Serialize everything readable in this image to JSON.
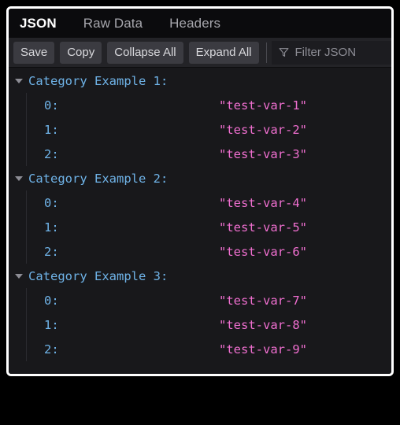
{
  "panel": {
    "name": "firefox-devtools-json-viewer"
  },
  "tabs": [
    {
      "label": "JSON",
      "active": true
    },
    {
      "label": "Raw Data",
      "active": false
    },
    {
      "label": "Headers",
      "active": false
    }
  ],
  "toolbar": {
    "save_label": "Save",
    "copy_label": "Copy",
    "collapse_all_label": "Collapse All",
    "expand_all_label": "Expand All",
    "filter_placeholder": "Filter JSON",
    "filter_value": "",
    "filter_icon": "funnel-icon"
  },
  "tree": {
    "twisty_icon": "triangle-down-icon",
    "groups": [
      {
        "key": "Category Example 1:",
        "expanded": true,
        "items": [
          {
            "key": "0:",
            "value": "\"test-var-1\""
          },
          {
            "key": "1:",
            "value": "\"test-var-2\""
          },
          {
            "key": "2:",
            "value": "\"test-var-3\""
          }
        ]
      },
      {
        "key": "Category Example 2:",
        "expanded": true,
        "items": [
          {
            "key": "0:",
            "value": "\"test-var-4\""
          },
          {
            "key": "1:",
            "value": "\"test-var-5\""
          },
          {
            "key": "2:",
            "value": "\"test-var-6\""
          }
        ]
      },
      {
        "key": "Category Example 3:",
        "expanded": true,
        "items": [
          {
            "key": "0:",
            "value": "\"test-var-7\""
          },
          {
            "key": "1:",
            "value": "\"test-var-8\""
          },
          {
            "key": "2:",
            "value": "\"test-var-9\""
          }
        ]
      }
    ]
  },
  "colors": {
    "panel_background": "#18181b",
    "tabbar_background": "#0b0b0d",
    "toolbar_background": "#232327",
    "button_background": "#3b3b41",
    "key_color": "#6fb3e8",
    "string_color": "#f06fd0",
    "border_color": "#ffffff"
  }
}
